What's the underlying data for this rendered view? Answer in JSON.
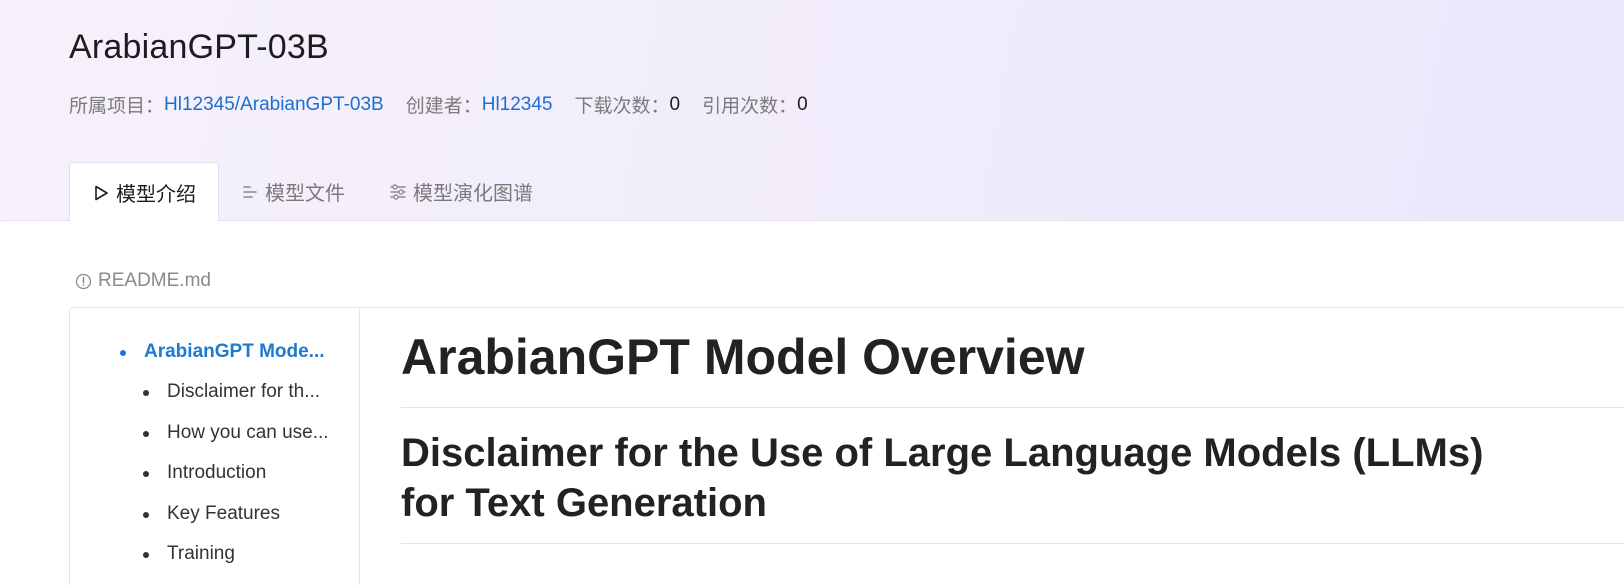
{
  "header": {
    "title": "ArabianGPT-03B",
    "meta": {
      "project_label": "所属项目：",
      "project_link": "Hl12345/ArabianGPT-03B",
      "creator_label": "创建者：",
      "creator_link": "Hl12345",
      "downloads_label": "下载次数：",
      "downloads_value": "0",
      "citations_label": "引用次数：",
      "citations_value": "0"
    }
  },
  "tabs": [
    {
      "label": "模型介绍",
      "icon": "play-icon",
      "active": true
    },
    {
      "label": "模型文件",
      "icon": "file-list-icon",
      "active": false
    },
    {
      "label": "模型演化图谱",
      "icon": "sliders-icon",
      "active": false
    }
  ],
  "readme": {
    "filename": "README.md",
    "icon": "info-circle-icon"
  },
  "toc": {
    "items": [
      {
        "label": "ArabianGPT Mode...",
        "level": 1,
        "active": true
      },
      {
        "label": "Disclaimer for th...",
        "level": 2,
        "active": false
      },
      {
        "label": "How you can use...",
        "level": 2,
        "active": false
      },
      {
        "label": "Introduction",
        "level": 2,
        "active": false
      },
      {
        "label": "Key Features",
        "level": 2,
        "active": false
      },
      {
        "label": "Training",
        "level": 2,
        "active": false
      }
    ]
  },
  "content": {
    "h1": "ArabianGPT Model Overview",
    "h2": "Disclaimer for the Use of Large Language Models (LLMs) for Text Generation"
  },
  "colors": {
    "link": "#1c6fd1",
    "toc_active": "#1c7ad3",
    "header_bg": "#f3eefb"
  }
}
